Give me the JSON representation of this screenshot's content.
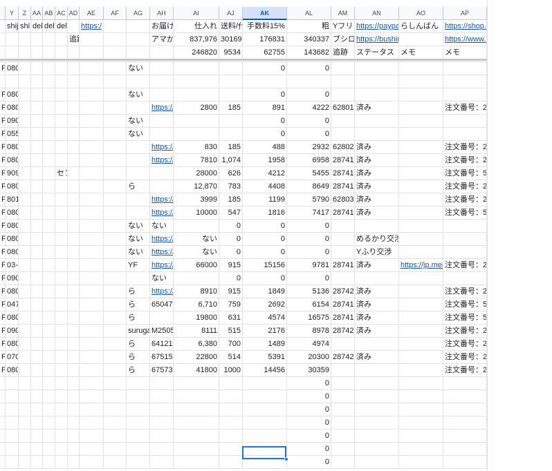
{
  "columns": [
    "",
    "Y",
    "Z",
    "AA",
    "AB",
    "AC",
    "AD",
    "AE",
    "AF",
    "AG",
    "AH",
    "AI",
    "AJ",
    "AK",
    "AL",
    "AM",
    "AN",
    "AO",
    "AP"
  ],
  "active_column": "AK",
  "header_rows": [
    [
      "",
      "shij",
      "shi",
      "deli",
      "deli",
      "deli",
      "",
      "https:/",
      "",
      "",
      "お届け",
      "仕入れ",
      "送料/代",
      "手数料15%",
      "粗",
      "Yフリ",
      "https://paypa",
      "らしんばん",
      "https://shop.l"
    ],
    [
      "",
      "",
      "",
      "",
      "",
      "",
      "追跡",
      "",
      "",
      "",
      "アマか",
      "837,976",
      "30169",
      "176831",
      "340337",
      "ブシロ",
      "https://bushir",
      "",
      "https://www.l"
    ],
    [
      "",
      "",
      "",
      "",
      "",
      "",
      "",
      "",
      "",
      "",
      "",
      "246820",
      "9534",
      "62755",
      "143682",
      "追跡",
      "ステータス",
      "メモ",
      "メモ"
    ]
  ],
  "rows": [
    [
      "P",
      "080",
      "",
      "",
      "",
      "",
      "",
      "",
      "",
      "ない",
      "",
      "",
      "",
      "0",
      "0",
      "",
      "",
      "",
      ""
    ],
    [
      "",
      "",
      "",
      "",
      "",
      "",
      "",
      "",
      "",
      "",
      "",
      "",
      "",
      "",
      "",
      "",
      "",
      "",
      ""
    ],
    [
      "P",
      "080",
      "",
      "",
      "",
      "",
      "",
      "",
      "",
      "ない",
      "",
      "",
      "",
      "0",
      "0",
      "",
      "",
      "",
      ""
    ],
    [
      "P",
      "080",
      "",
      "",
      "",
      "",
      "",
      "",
      "",
      "",
      "https://",
      "2800",
      "185",
      "891",
      "4222",
      "628014",
      "済み",
      "",
      "注文番号：2"
    ],
    [
      "P",
      "090",
      "",
      "",
      "",
      "",
      "",
      "",
      "",
      "ない",
      "",
      "",
      "",
      "0",
      "0",
      "",
      "",
      "",
      ""
    ],
    [
      "P",
      "055",
      "",
      "",
      "",
      "",
      "",
      "",
      "",
      "ない",
      "",
      "",
      "",
      "0",
      "0",
      "",
      "",
      "",
      ""
    ],
    [
      "P",
      "080",
      "",
      "",
      "",
      "",
      "",
      "",
      "",
      "",
      "https://",
      "830",
      "185",
      "488",
      "2932",
      "628020",
      "済み",
      "",
      "注文番号：2"
    ],
    [
      "P",
      "080",
      "",
      "",
      "",
      "",
      "",
      "",
      "",
      "",
      "https://",
      "7810",
      "1,074",
      "1958",
      "6958",
      "287416",
      "済み",
      "",
      "注文番号：2"
    ],
    [
      "P",
      "909",
      "",
      "",
      "",
      "セフ",
      "",
      "",
      "",
      "",
      "",
      "28000",
      "626",
      "4212",
      "5455",
      "287417",
      "済み",
      "",
      "注文番号：5"
    ],
    [
      "P",
      "080",
      "",
      "",
      "",
      "",
      "",
      "",
      "",
      "ら",
      "",
      "12,870",
      "783",
      "4408",
      "8649",
      "287417",
      "済み",
      "",
      "注文番号：2"
    ],
    [
      "P",
      "801",
      "",
      "",
      "",
      "",
      "",
      "",
      "",
      "",
      "https://",
      "3999",
      "185",
      "1199",
      "5790",
      "628031",
      "済み",
      "",
      "注文番号：2"
    ],
    [
      "P",
      "080",
      "",
      "",
      "",
      "",
      "",
      "",
      "",
      "",
      "https://",
      "10000",
      "547",
      "1816",
      "7417",
      "287417",
      "済み",
      "",
      "注文番号：5"
    ],
    [
      "P",
      "080",
      "",
      "",
      "",
      "",
      "",
      "",
      "",
      "ない",
      "ない",
      "",
      "0",
      "0",
      "0",
      "",
      "",
      "",
      ""
    ],
    [
      "P",
      "080",
      "",
      "",
      "",
      "",
      "",
      "",
      "",
      "ない",
      "https://",
      "ない",
      "0",
      "0",
      "0",
      "",
      "めるかり交渉",
      "",
      ""
    ],
    [
      "P",
      "080",
      "",
      "",
      "",
      "",
      "",
      "",
      "",
      "ない",
      "https://",
      "ない",
      "0",
      "0",
      "0",
      "",
      "Yふり交渉",
      "",
      ""
    ],
    [
      "P",
      "03-",
      "",
      "",
      "",
      "",
      "",
      "",
      "",
      "YF",
      "https://",
      "66000",
      "915",
      "15156",
      "9781",
      "287418",
      "済み",
      "https://jp.mer",
      "注文番号：2"
    ],
    [
      "P",
      "090",
      "",
      "",
      "",
      "",
      "",
      "",
      "",
      "",
      "ない",
      "",
      "0",
      "0",
      "0",
      "",
      "",
      "",
      ""
    ],
    [
      "P",
      "080",
      "",
      "",
      "",
      "",
      "",
      "",
      "",
      "ら",
      "https://",
      "8910",
      "915",
      "1849",
      "5136",
      "287420",
      "済み",
      "",
      "注文番号：2"
    ],
    [
      "P",
      "047",
      "",
      "",
      "",
      "",
      "",
      "",
      "",
      "ら",
      "650470",
      "6,710",
      "759",
      "2692",
      "6154",
      "287419",
      "済み",
      "",
      "注文番号：5"
    ],
    [
      "P",
      "080",
      "",
      "",
      "",
      "",
      "",
      "",
      "",
      "ら",
      "",
      "19800",
      "631",
      "4574",
      "16575",
      "287419",
      "済み",
      "",
      "注文番号：5"
    ],
    [
      "P",
      "090",
      "",
      "",
      "",
      "",
      "",
      "",
      "",
      "suruga",
      "M2505",
      "8111",
      "515",
      "2176",
      "8978",
      "287420",
      "済み",
      "",
      "注文番号：2"
    ],
    [
      "P",
      "080",
      "",
      "",
      "",
      "",
      "",
      "",
      "",
      "ら",
      "641215",
      "6,380",
      "700",
      "1489",
      "4974",
      "",
      "",
      "",
      "注文番号：2"
    ],
    [
      "P",
      "070",
      "",
      "",
      "",
      "",
      "",
      "",
      "",
      "ら",
      "675150",
      "22800",
      "514",
      "5391",
      "20300",
      "287420",
      "済み",
      "",
      "注文番号：2"
    ],
    [
      "P",
      "080",
      "",
      "",
      "",
      "",
      "",
      "",
      "",
      "ら",
      "67573",
      "41800",
      "1000",
      "14456",
      "30359",
      "",
      "",
      "",
      "注文番号：2"
    ],
    [
      "",
      "",
      "",
      "",
      "",
      "",
      "",
      "",
      "",
      "",
      "",
      "",
      "",
      "",
      "0",
      "",
      "",
      "",
      ""
    ],
    [
      "",
      "",
      "",
      "",
      "",
      "",
      "",
      "",
      "",
      "",
      "",
      "",
      "",
      "",
      "0",
      "",
      "",
      "",
      ""
    ],
    [
      "",
      "",
      "",
      "",
      "",
      "",
      "",
      "",
      "",
      "",
      "",
      "",
      "",
      "",
      "0",
      "",
      "",
      "",
      ""
    ],
    [
      "",
      "",
      "",
      "",
      "",
      "",
      "",
      "",
      "",
      "",
      "",
      "",
      "",
      "",
      "0",
      "",
      "",
      "",
      ""
    ],
    [
      "",
      "",
      "",
      "",
      "",
      "",
      "",
      "",
      "",
      "",
      "",
      "",
      "",
      "",
      "0",
      "",
      "",
      "",
      ""
    ],
    [
      "",
      "",
      "",
      "",
      "",
      "",
      "",
      "",
      "",
      "",
      "",
      "",
      "",
      "",
      "0",
      "",
      "",
      "",
      ""
    ],
    [
      "",
      "",
      "",
      "",
      "",
      "",
      "",
      "",
      "",
      "",
      "",
      "",
      "",
      "",
      "0",
      "",
      "",
      "",
      ""
    ]
  ]
}
